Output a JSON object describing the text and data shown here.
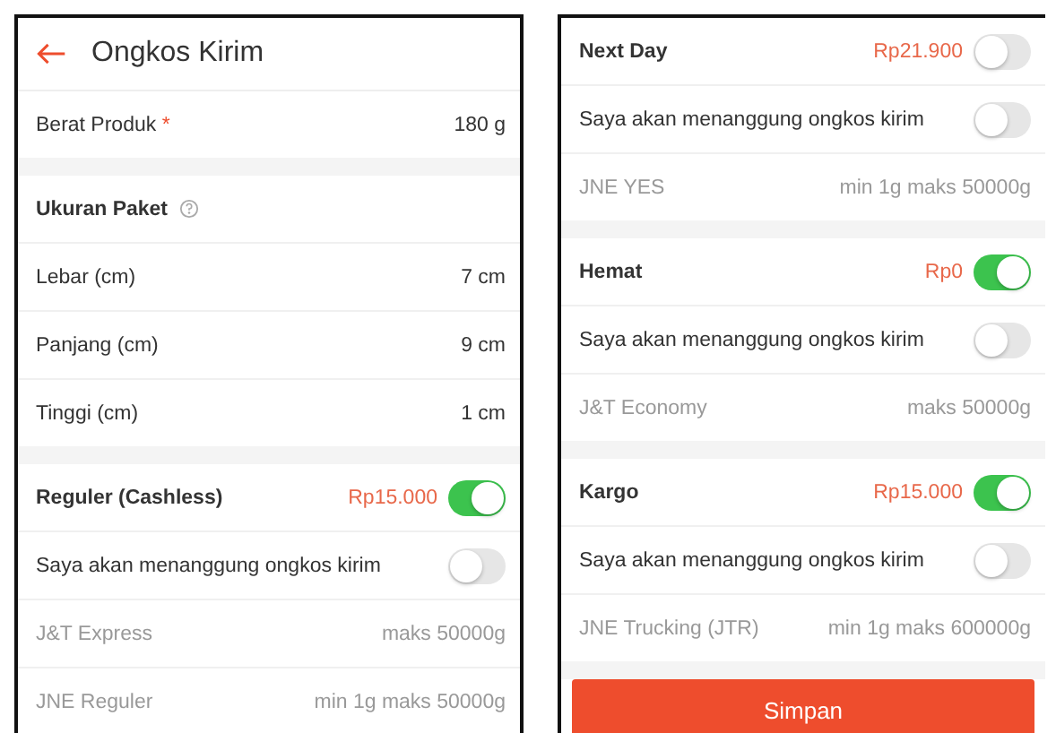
{
  "panels": [
    {
      "header": {
        "title": "Ongkos Kirim"
      },
      "sections": [
        {
          "rows": [
            {
              "kind": "field",
              "label": "Berat Produk",
              "required_mark": "*",
              "value": "180 g"
            }
          ]
        },
        {
          "rows": [
            {
              "kind": "heading",
              "label": "Ukuran Paket"
            },
            {
              "kind": "field",
              "label": "Lebar (cm)",
              "value": "7 cm"
            },
            {
              "kind": "field",
              "label": "Panjang (cm)",
              "value": "9 cm"
            },
            {
              "kind": "field",
              "label": "Tinggi (cm)",
              "value": "1 cm"
            }
          ]
        },
        {
          "rows": [
            {
              "kind": "service",
              "label": "Reguler (Cashless)",
              "price": "Rp15.000",
              "on": true
            },
            {
              "kind": "toggle",
              "label": "Saya akan menanggung ongkos kirim",
              "on": false
            },
            {
              "kind": "courier",
              "label": "J&T Express",
              "value": "maks 50000g"
            },
            {
              "kind": "courier",
              "label": "JNE Reguler",
              "value": "min 1g maks 50000g"
            }
          ]
        }
      ]
    },
    {
      "sections": [
        {
          "rows": [
            {
              "kind": "service",
              "label": "Next Day",
              "price": "Rp21.900",
              "on": false
            },
            {
              "kind": "toggle",
              "label": "Saya akan menanggung ongkos kirim",
              "on": false
            },
            {
              "kind": "courier",
              "label": "JNE YES",
              "value": "min 1g maks 50000g"
            }
          ]
        },
        {
          "rows": [
            {
              "kind": "service",
              "label": "Hemat",
              "price": "Rp0",
              "on": true
            },
            {
              "kind": "toggle",
              "label": "Saya akan menanggung ongkos kirim",
              "on": false
            },
            {
              "kind": "courier",
              "label": "J&T Economy",
              "value": "maks 50000g"
            }
          ]
        },
        {
          "rows": [
            {
              "kind": "service",
              "label": "Kargo",
              "price": "Rp15.000",
              "on": true
            },
            {
              "kind": "toggle",
              "label": "Saya akan menanggung ongkos kirim",
              "on": false
            },
            {
              "kind": "courier",
              "label": "JNE Trucking (JTR)",
              "value": "min 1g maks 600000g"
            }
          ]
        }
      ],
      "button": {
        "label": "Simpan"
      }
    }
  ]
}
